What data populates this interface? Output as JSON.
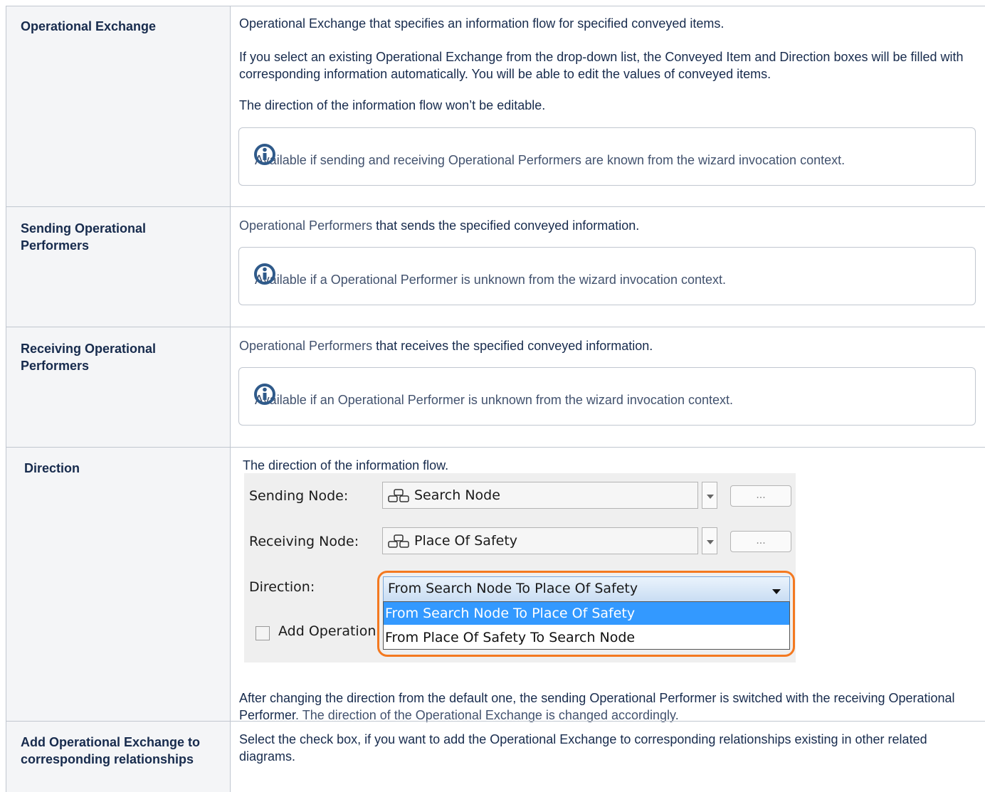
{
  "rows": [
    {
      "header": "Operational Exchange",
      "paragraphs": [
        "Operational Exchange that specifies an information flow for specified conveyed items.",
        "If you select an existing Operational Exchange from the drop-down list, the Conveyed Item and Direction boxes will be filled with corresponding information automatically. You will be able to edit the values of conveyed items.",
        "The direction of the information flow won’t be editable."
      ],
      "info": "Available if sending and receiving Operational Performers are known from the wizard invocation context."
    },
    {
      "header": "Sending Operational Performers",
      "link": "Operational Performers",
      "text": " that sends the specified conveyed information.",
      "info": "Available if a Operational Performer is unknown from the wizard invocation context."
    },
    {
      "header": "Receiving Operational Performers",
      "link": "Operational Performers",
      "text": " that receives the specified conveyed information.",
      "info": "Available if an Operational Performer is unknown from the wizard invocation context."
    },
    {
      "header": "Direction",
      "intro": "The direction of the information flow.",
      "after_a": "After changing the direction from the default one, the sending Operational Performer is switched with the receiving Operational Performer",
      "after_b": ". The direction of the Operational Exchange is changed accordingly."
    },
    {
      "header": "Add Operational Exchange to corresponding relationships",
      "text": "Select the check box, if you want to add the Operational Exchange to corresponding relationships existing in other related diagrams."
    }
  ],
  "screenshot": {
    "sending_label": "Sending Node:",
    "sending_value": "Search Node",
    "receiving_label": "Receiving Node:",
    "receiving_value": "Place Of Safety",
    "dots": "...",
    "direction_label": "Direction:",
    "direction_value": "From Search Node To Place Of Safety",
    "options": [
      "From Search Node To Place Of Safety",
      "From Place Of Safety To Search Node"
    ],
    "checkbox_label": "Add Operational Exchange"
  },
  "colors": {
    "accent": "#f47920",
    "selection": "#3399ff",
    "header_bg": "#f4f5f7"
  }
}
